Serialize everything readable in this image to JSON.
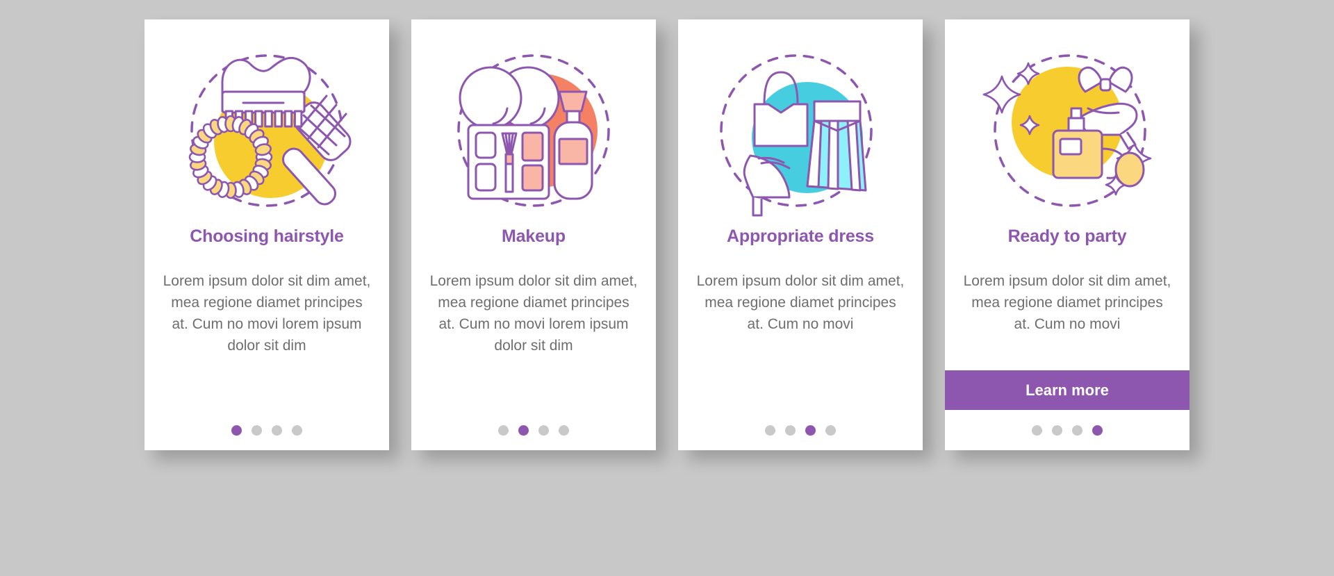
{
  "page": {
    "background_color": "#c8c8c8",
    "card_background": "#ffffff",
    "accent_purple": "#8d56af",
    "body_text_color": "#6e6e6e",
    "dot_inactive_color": "#c9c9c9",
    "yellow": "#f7cc2e",
    "coral": "#f58164",
    "coral_light": "#f9b6a6",
    "cyan": "#46cddf",
    "cyan_light": "#8ef0fa",
    "total_steps": 4
  },
  "cards": [
    {
      "title": "Choosing hairstyle",
      "description": "Lorem ipsum dolor sit dim amet, mea regione diamet principes at. Cum no movi lorem ipsum dolor sit dim",
      "illustration_name": "hairstyle-illustration",
      "illustration_items": [
        "hair-clip",
        "scrunchie",
        "hair-brush"
      ],
      "active_dot": 1,
      "has_button": false,
      "button_label": ""
    },
    {
      "title": "Makeup",
      "description": "Lorem ipsum dolor sit dim amet, mea regione diamet principes at. Cum no movi lorem ipsum dolor sit dim",
      "illustration_name": "makeup-illustration",
      "illustration_items": [
        "cotton-pads",
        "makeup-palette",
        "lotion-bottle"
      ],
      "active_dot": 2,
      "has_button": false,
      "button_label": ""
    },
    {
      "title": "Appropriate dress",
      "description": "Lorem ipsum dolor sit dim amet, mea regione diamet principes at. Cum no movi",
      "illustration_name": "dress-illustration",
      "illustration_items": [
        "crop-top",
        "pleated-skirt",
        "high-heel-shoe"
      ],
      "active_dot": 3,
      "has_button": false,
      "button_label": ""
    },
    {
      "title": "Ready to party",
      "description": "Lorem ipsum dolor sit dim amet, mea regione diamet principes at. Cum no movi",
      "illustration_name": "party-illustration",
      "illustration_items": [
        "perfume-bottle",
        "high-heel-shoe",
        "bow-tie",
        "sparkles"
      ],
      "active_dot": 4,
      "has_button": true,
      "button_label": "Learn more"
    }
  ]
}
